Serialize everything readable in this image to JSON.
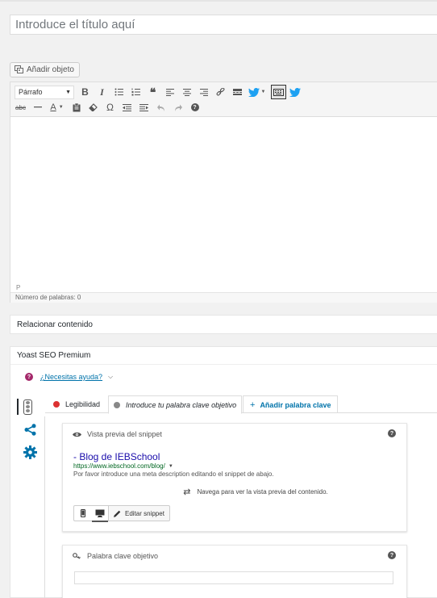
{
  "editor": {
    "title_placeholder": "Introduce el título aquí",
    "add_media_label": "Añadir objeto",
    "format_select_value": "Párrafo",
    "path": "P",
    "word_count": "Número de palabras: 0"
  },
  "boxes": {
    "related_title": "Relacionar contenido",
    "yoast_title": "Yoast SEO Premium"
  },
  "yoast": {
    "help_link": "¿Necesitas ayuda?",
    "tabs": {
      "readability": "Legibilidad",
      "keyword": "Introduce tu palabra clave objetivo",
      "add_keyword": "Añadir palabra clave"
    },
    "snippet": {
      "header": "Vista previa del snippet",
      "title": "- Blog de IEBSchool",
      "url": "https://www.iebschool.com/blog/",
      "description": "Por favor introduce una meta description editando el snippet de abajo.",
      "nav_hint": "Navega para ver la vista previa del contenido.",
      "edit_label": "Editar snippet"
    },
    "keyword_box": {
      "header": "Palabra clave objetivo",
      "value": ""
    }
  },
  "colors": {
    "link": "#0073aa",
    "snippet_title": "#1a0dab",
    "snippet_url": "#006621",
    "readability_dot": "#dc3232",
    "keyword_dot": "#888888",
    "twitter": "#1da1f2",
    "yoast_purple": "#a4286a",
    "gear_blue": "#0073aa"
  }
}
